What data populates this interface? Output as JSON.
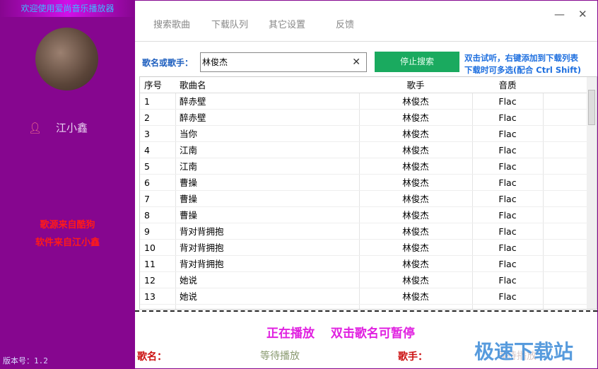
{
  "sidebar": {
    "welcome": "欢迎使用爱尚音乐播放器",
    "username": "江小鑫",
    "credit1": "歌源来自酷狗",
    "credit2": "软件来自江小鑫",
    "version": "版本号：1.2"
  },
  "tabs": [
    "搜索歌曲",
    "下载队列",
    "其它设置",
    "反馈"
  ],
  "search": {
    "label": "歌名或歌手：",
    "value": "林俊杰",
    "stop_label": "停止搜索",
    "hint1": "双击试听，右键添加到下载列表",
    "hint2": "下载时可多选(配合 Ctrl Shift)"
  },
  "table": {
    "headers": [
      "序号",
      "歌曲名",
      "歌手",
      "音质"
    ],
    "rows": [
      [
        "1",
        "醉赤壁",
        "林俊杰",
        "Flac"
      ],
      [
        "2",
        "醉赤壁",
        "林俊杰",
        "Flac"
      ],
      [
        "3",
        "当你",
        "林俊杰",
        "Flac"
      ],
      [
        "4",
        "江南",
        "林俊杰",
        "Flac"
      ],
      [
        "5",
        "江南",
        "林俊杰",
        "Flac"
      ],
      [
        "6",
        "曹操",
        "林俊杰",
        "Flac"
      ],
      [
        "7",
        "曹操",
        "林俊杰",
        "Flac"
      ],
      [
        "8",
        "曹操",
        "林俊杰",
        "Flac"
      ],
      [
        "9",
        "背对背拥抱",
        "林俊杰",
        "Flac"
      ],
      [
        "10",
        "背对背拥抱",
        "林俊杰",
        "Flac"
      ],
      [
        "11",
        "背对背拥抱",
        "林俊杰",
        "Flac"
      ],
      [
        "12",
        "她说",
        "林俊杰",
        "Flac"
      ],
      [
        "13",
        "她说",
        "林俊杰",
        "Flac"
      ]
    ]
  },
  "player": {
    "status": "正在播放　 双击歌名可暂停",
    "song_label": "歌名：",
    "song_value": "等待播放",
    "artist_label": "歌手：",
    "artist_value": "等待播放"
  },
  "watermark": "极速下载站"
}
